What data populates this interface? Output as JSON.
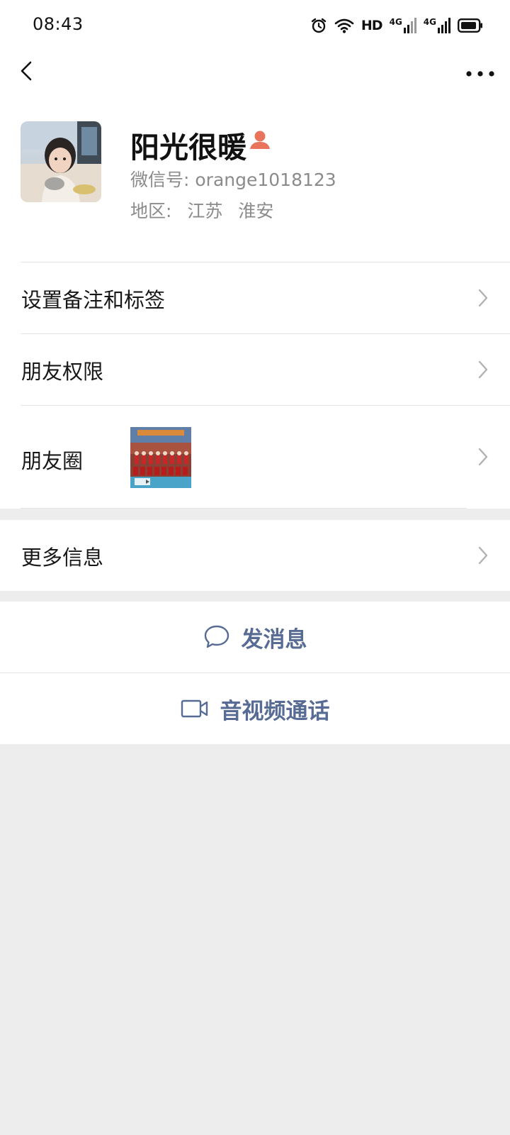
{
  "status_bar": {
    "time": "08:43",
    "hd_label": "HD",
    "network_1": "4G",
    "network_2": "4G"
  },
  "profile": {
    "name": "阳光很暖",
    "wechat_id": "微信号: orange1018123",
    "region_label": "地区:",
    "region_province": "江苏",
    "region_city": "淮安",
    "gender_icon": "female-icon",
    "gender_color": "#e8745c"
  },
  "menu": {
    "remark_tags": "设置备注和标签",
    "friend_permissions": "朋友权限",
    "moments": "朋友圈",
    "more_info": "更多信息"
  },
  "actions": {
    "send_message": "发消息",
    "video_call": "音视频通话"
  },
  "colors": {
    "link_blue": "#576b95",
    "background_gray": "#ededed",
    "text_secondary": "#8b8b8b"
  }
}
